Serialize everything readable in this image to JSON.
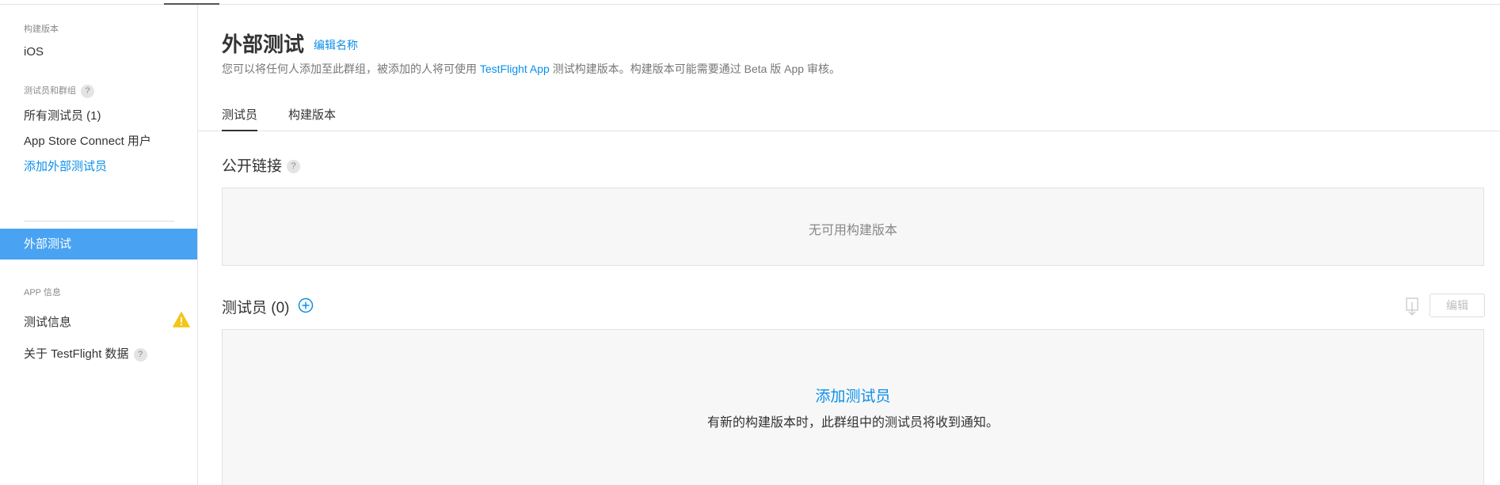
{
  "sidebar": {
    "section_builds": "构建版本",
    "ios": "iOS",
    "section_testers": "测试员和群组",
    "help_mark": "?",
    "all_testers": "所有测试员 (1)",
    "asc_users": "App Store Connect 用户",
    "add_external": "添加外部测试员",
    "active_group": "外部测试",
    "section_app_info": "APP 信息",
    "test_info": "测试信息",
    "about_data": "关于 TestFlight 数据"
  },
  "header": {
    "title": "外部测试",
    "edit_name": "编辑名称",
    "subtitle_before": "您可以将任何人添加至此群组，被添加的人将可使用 ",
    "subtitle_link": "TestFlight App",
    "subtitle_after": " 测试构建版本。构建版本可能需要通过 Beta 版 App 审核。"
  },
  "tabs": [
    {
      "label": "测试员",
      "active": true
    },
    {
      "label": "构建版本",
      "active": false
    }
  ],
  "public_link": {
    "title": "公开链接",
    "empty_text": "无可用构建版本"
  },
  "testers": {
    "title": "测试员 (0)",
    "edit_label": "编辑",
    "add_link": "添加测试员",
    "notify_text": "有新的构建版本时，此群组中的测试员将收到通知。"
  },
  "icons": {
    "help": "question-mark-icon",
    "warning": "warning-triangle-icon",
    "add": "plus-circle-icon",
    "download": "download-icon"
  },
  "colors": {
    "accent": "#0b8fe8",
    "active_bg": "#4aa3f2",
    "warning": "#f5c518"
  }
}
